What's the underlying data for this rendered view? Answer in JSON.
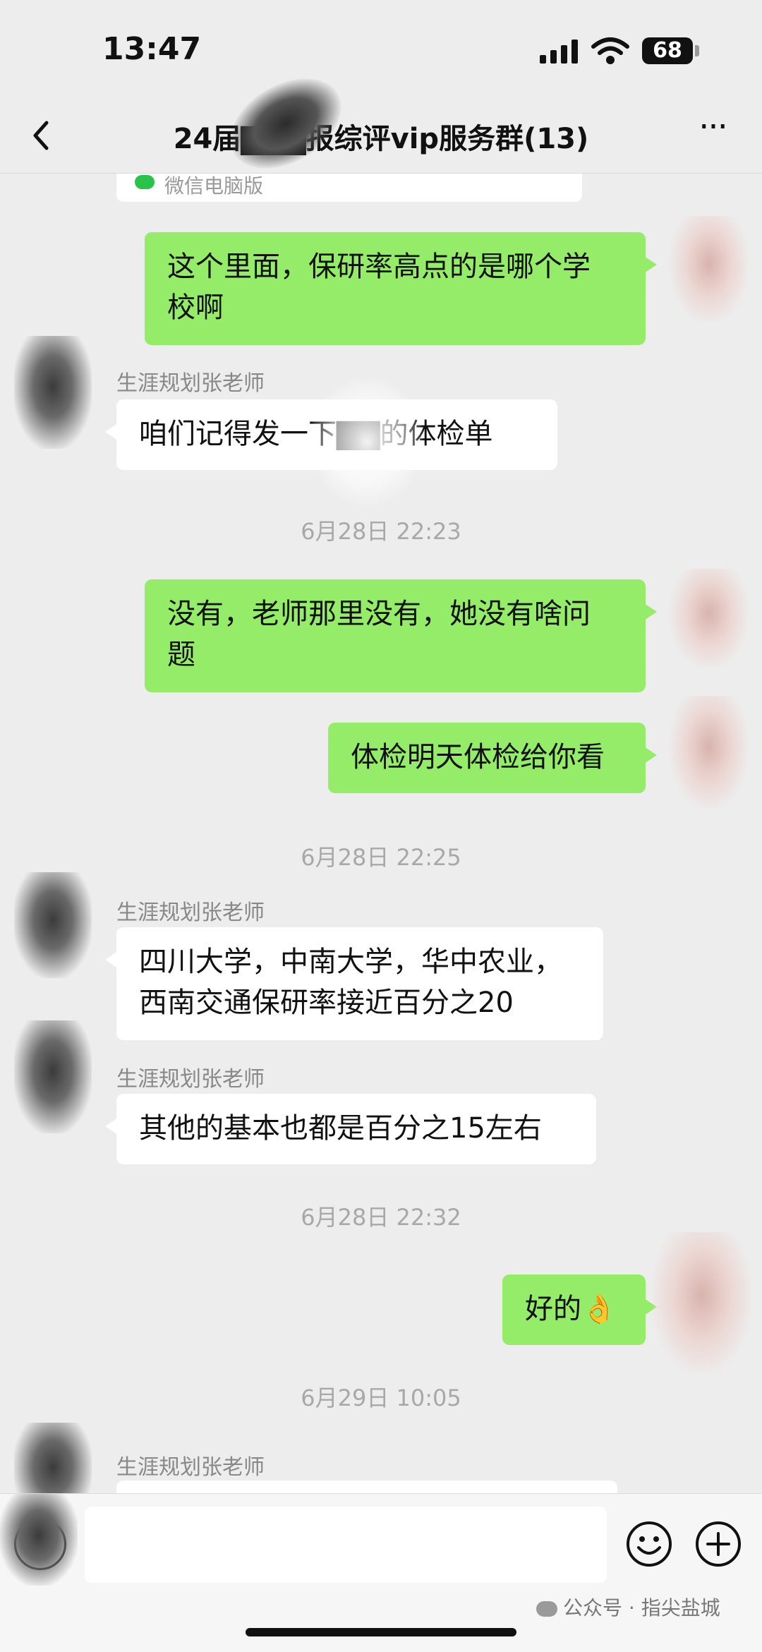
{
  "status_bar": {
    "time": "13:47",
    "battery": "68"
  },
  "header": {
    "title": "24届▇▇▇报综评vip服务群(13)",
    "more": "···"
  },
  "chat": {
    "link_card_source": "微信电脑版",
    "messages": [
      {
        "text_lines": [
          "这个里面，保研率高点的是哪个学",
          "校啊"
        ]
      },
      {
        "sender": "生涯规划张老师",
        "text": "咱们记得发一下▇▇的体检单"
      },
      {
        "timestamp": "6月28日 22:23"
      },
      {
        "text_lines": [
          "没有，老师那里没有，她没有啥问",
          "题"
        ]
      },
      {
        "text": "体检明天体检给你看"
      },
      {
        "timestamp": "6月28日 22:25"
      },
      {
        "sender": "生涯规划张老师",
        "text_lines": [
          "四川大学，中南大学，华中农业，",
          "西南交通保研率接近百分之20"
        ]
      },
      {
        "sender": "生涯规划张老师",
        "text": "其他的基本也都是百分之15左右"
      },
      {
        "timestamp": "6月28日 22:32"
      },
      {
        "text": "好的👌"
      },
      {
        "timestamp": "6月29日 10:05"
      },
      {
        "sender": "生涯规划张老师"
      }
    ]
  },
  "watermark": "公众号 · 指尖盐城",
  "icons": {
    "back": "chevron-left-icon",
    "more": "more-icon",
    "voice": "voice-icon",
    "emoji": "emoji-icon",
    "plus": "plus-icon"
  },
  "colors": {
    "my_bubble": "#95ec69",
    "other_bubble": "#ffffff",
    "background": "#ededed"
  }
}
